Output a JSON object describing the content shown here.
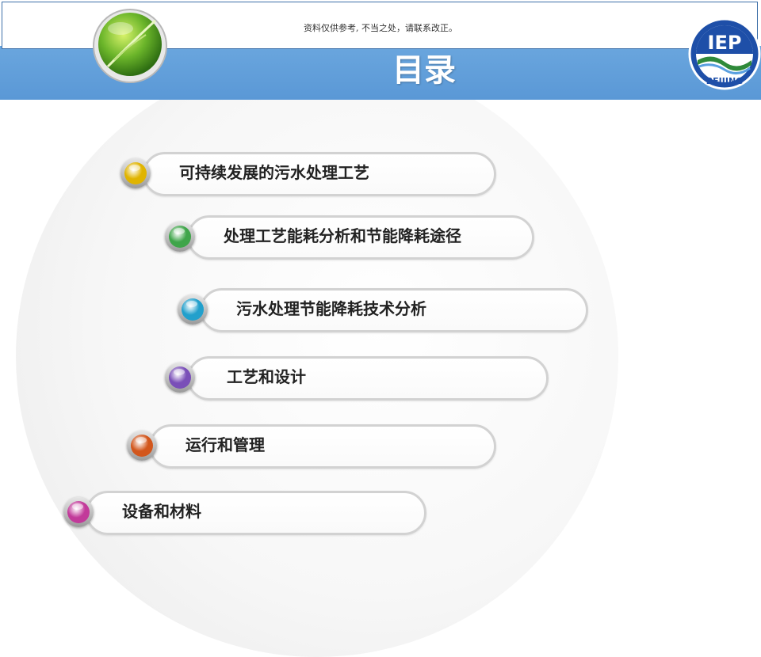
{
  "notice": "资料仅供参考, 不当之处，请联系改正。",
  "title": "目录",
  "logo_right": {
    "top_text": "IEP",
    "bottom_text": "BEIJING"
  },
  "toc": [
    {
      "label": "可持续发展的污水处理工艺",
      "color": "#e0b400"
    },
    {
      "label": "处理工艺能耗分析和节能降耗途径",
      "color": "#3fa54a"
    },
    {
      "label": "污水处理节能降耗技术分析",
      "color": "#22a0cc"
    },
    {
      "label": "工艺和设计",
      "color": "#7a4fb8"
    },
    {
      "label": "运行和管理",
      "color": "#d2561c"
    },
    {
      "label": "设备和材料",
      "color": "#c23a9a"
    }
  ]
}
